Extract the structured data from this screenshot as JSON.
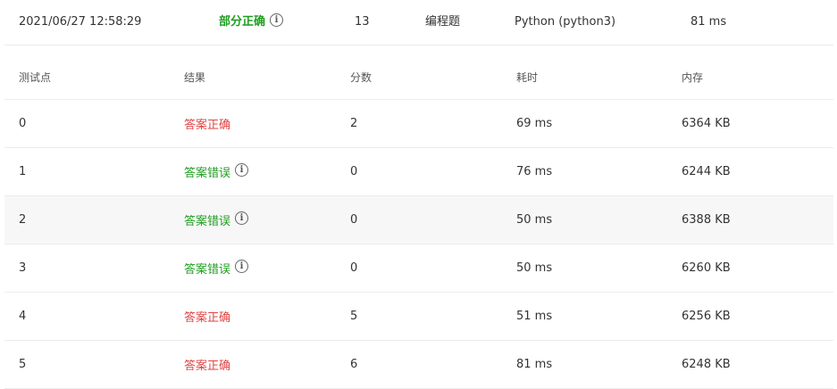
{
  "summary": {
    "time": "2021/06/27 12:58:29",
    "status": "部分正确",
    "score": "13",
    "type": "编程题",
    "language": "Python (python3)",
    "duration": "81 ms"
  },
  "table": {
    "headers": [
      "测试点",
      "结果",
      "分数",
      "耗时",
      "内存"
    ],
    "rows": [
      {
        "point": "0",
        "result": "答案正确",
        "score": "2",
        "time": "69 ms",
        "memory": "6364 KB"
      },
      {
        "point": "1",
        "result": "答案错误",
        "score": "0",
        "time": "76 ms",
        "memory": "6244 KB"
      },
      {
        "point": "2",
        "result": "答案错误",
        "score": "0",
        "time": "50 ms",
        "memory": "6388 KB"
      },
      {
        "point": "3",
        "result": "答案错误",
        "score": "0",
        "time": "50 ms",
        "memory": "6260 KB"
      },
      {
        "point": "4",
        "result": "答案正确",
        "score": "5",
        "time": "51 ms",
        "memory": "6256 KB"
      },
      {
        "point": "5",
        "result": "答案正确",
        "score": "6",
        "time": "81 ms",
        "memory": "6248 KB"
      }
    ]
  },
  "icons": {
    "info": "info-icon"
  },
  "colors": {
    "correct": "#e04343",
    "wrong": "#1f9e1f",
    "partial": "#1f9e1f"
  }
}
